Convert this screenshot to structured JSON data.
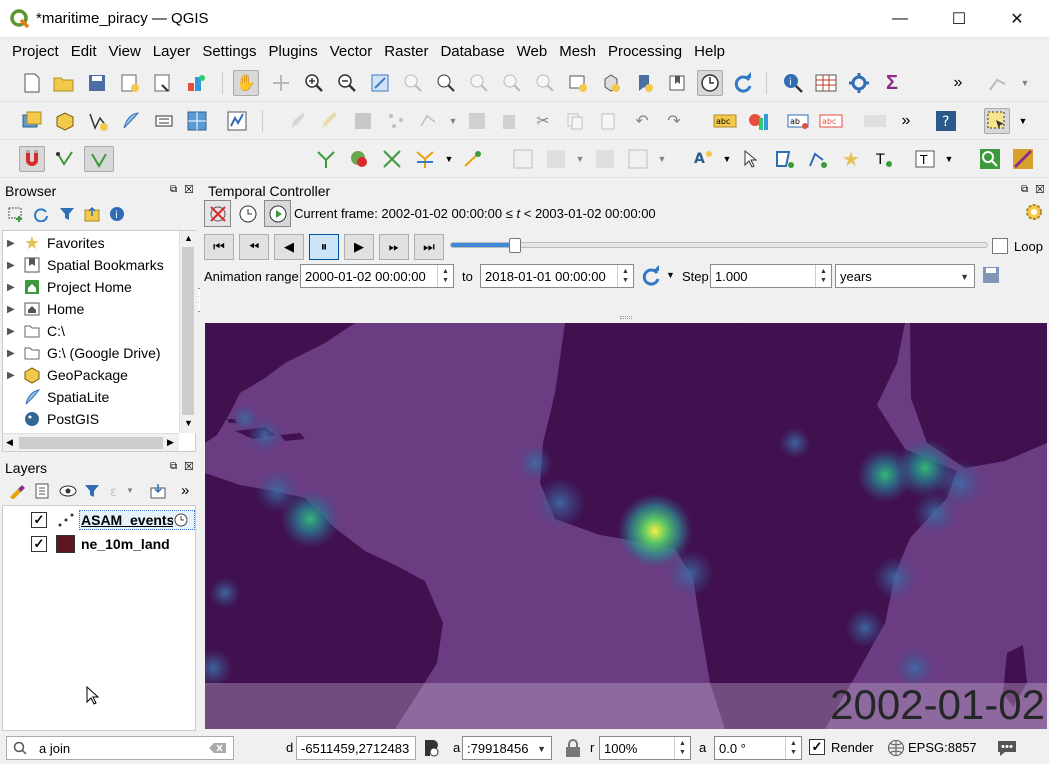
{
  "window": {
    "title": "*maritime_piracy — QGIS",
    "minimize": "—",
    "maximize": "☐",
    "close": "✕"
  },
  "menu": [
    "Project",
    "Edit",
    "View",
    "Layer",
    "Settings",
    "Plugins",
    "Vector",
    "Raster",
    "Database",
    "Web",
    "Mesh",
    "Processing",
    "Help"
  ],
  "digitizing": {
    "snap_tolerance": "10",
    "snap_unit": "px"
  },
  "browser": {
    "title": "Browser",
    "items": [
      "Favorites",
      "Spatial Bookmarks",
      "Project Home",
      "Home",
      "C:\\",
      "G:\\ (Google Drive)",
      "GeoPackage",
      "SpatiaLite",
      "PostGIS"
    ]
  },
  "layers": {
    "title": "Layers",
    "items": [
      {
        "name": "ASAM_events",
        "checked": true,
        "color": "#000000"
      },
      {
        "name": "ne_10m_land",
        "checked": true,
        "color": "#5c1822"
      }
    ]
  },
  "temporal": {
    "title": "Temporal Controller",
    "current_frame_prefix": "Current frame: 2002-01-02 00:00:00 ≤ ",
    "current_frame_var": "t",
    "current_frame_suffix": " < 2003-01-02 00:00:00",
    "loop_label": "Loop",
    "range_label": "Animation range",
    "range_from": "2000-01-02 00:00:00",
    "to_label": "to",
    "range_to": "2018-01-01 00:00:00",
    "step_label": "Step",
    "step_value": "1.000",
    "step_unit": "years",
    "slider_fraction": 0.11
  },
  "map": {
    "date_overlay": "2002-01-02"
  },
  "status": {
    "locator_value": "a join",
    "coord_label": "d",
    "coordinate": "-6511459,2712483",
    "scale_label": "a",
    "scale": ":79918456",
    "mag_label": "r",
    "magnifier": "100%",
    "rot_label": "a",
    "rotation": "0.0 °",
    "render_label": "Render",
    "crs": "EPSG:8857"
  },
  "colors": {
    "accent": "#3c9a3c",
    "land": "#40104f",
    "ocean": "#6a3d83",
    "highlight": "#f2e93c"
  }
}
